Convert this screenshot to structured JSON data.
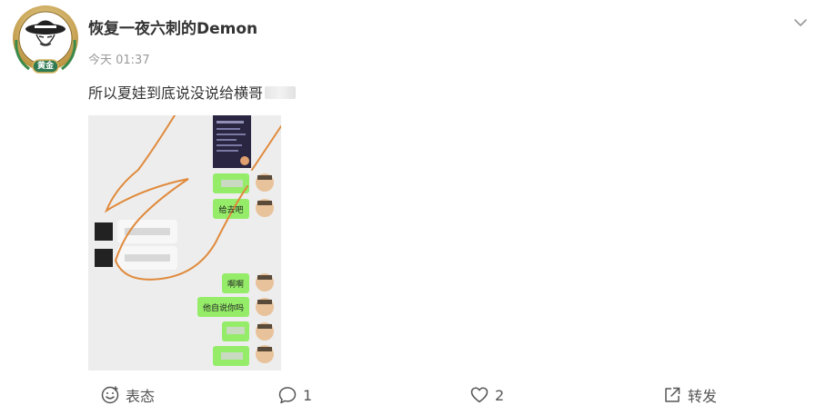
{
  "post": {
    "author": "恢复一夜六刺的Demon",
    "badge_text": "黄金",
    "timestamp": "今天 01:37",
    "text": "所以夏娃到底说没说给横哥"
  },
  "chat_image": {
    "messages": [
      {
        "text": "给去吧"
      },
      {
        "text": "啊啊"
      },
      {
        "text": "他自说你吗"
      }
    ]
  },
  "actions": {
    "react_label": "表态",
    "comment_count": "1",
    "like_count": "2",
    "share_label": "转发"
  },
  "colors": {
    "accent_green": "#95ec69",
    "annotation_orange": "#e08a3c",
    "text_gray": "#999999"
  }
}
